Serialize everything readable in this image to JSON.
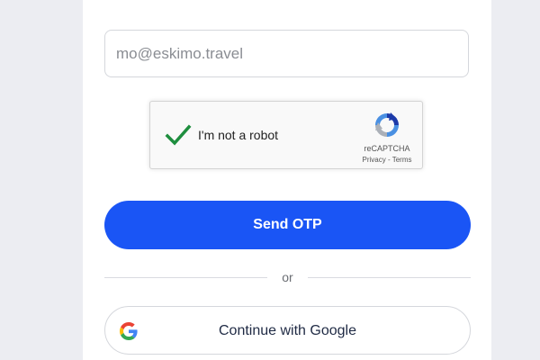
{
  "email": {
    "placeholder": "mo@eskimo.travel",
    "value": ""
  },
  "recaptcha": {
    "label": "I'm not a robot",
    "checked": true,
    "brand": "reCAPTCHA",
    "privacy": "Privacy",
    "separator": "-",
    "terms": "Terms",
    "check_color": "#1e8e3e"
  },
  "send_otp": {
    "label": "Send OTP",
    "color": "#1a55f5"
  },
  "divider": {
    "text": "or"
  },
  "google": {
    "label": "Continue with Google",
    "icon": "google-icon"
  }
}
